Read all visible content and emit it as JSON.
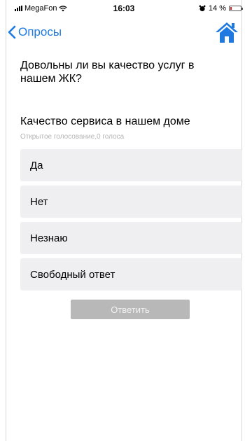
{
  "status_bar": {
    "carrier": "MegaFon",
    "time": "16:03",
    "battery": "14 %",
    "battery_level": 0.14
  },
  "nav": {
    "back_label": "Опросы",
    "home_icon": "home-icon",
    "accent_color": "#1e7ae0"
  },
  "question": "Довольны ли вы качество услуг в нашем ЖК?",
  "poll": {
    "title": "Качество сервиса в нашем доме",
    "subtitle": "Открытое голосование,0 голоса",
    "options": [
      "Да",
      "Нет",
      "Незнаю",
      "Свободный ответ"
    ],
    "submit_label": "Ответить"
  }
}
